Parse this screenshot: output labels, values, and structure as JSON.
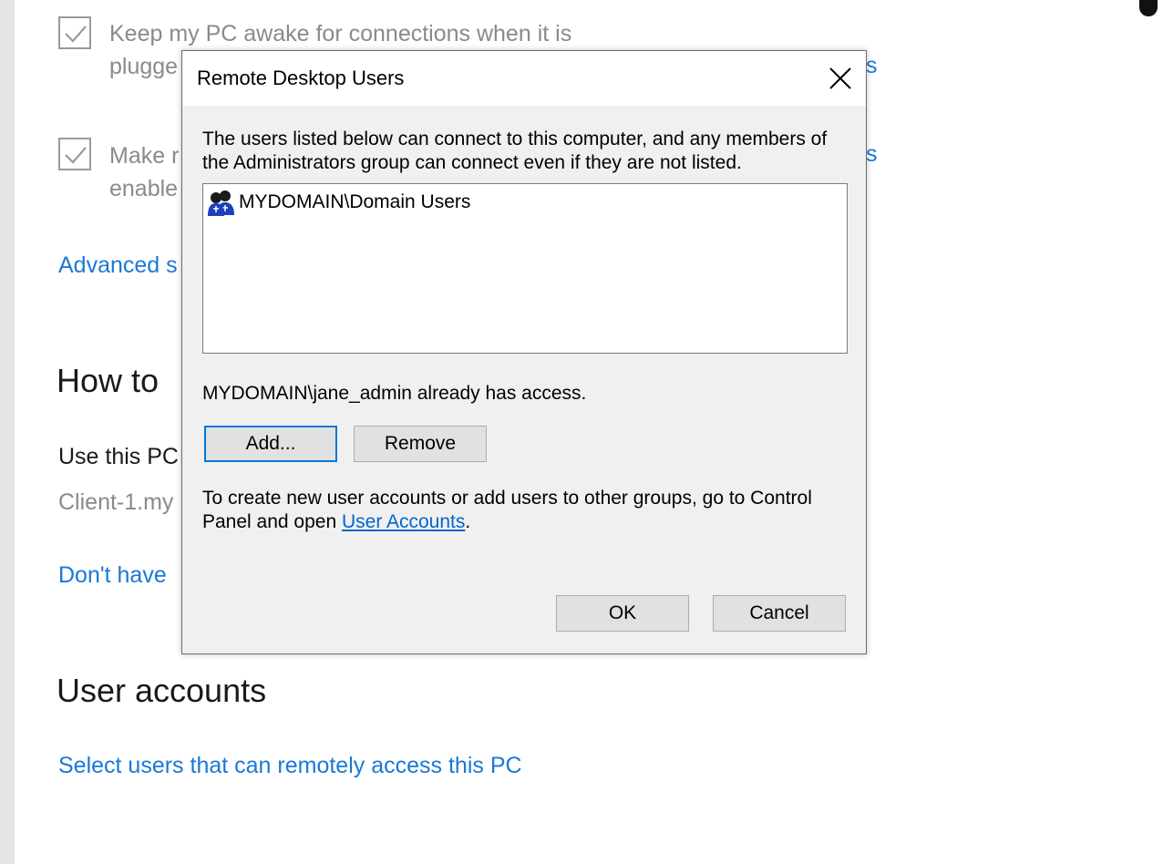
{
  "settings": {
    "keep_awake_text_line1": "Keep my PC awake for connections when it is",
    "keep_awake_text_line2": "plugge",
    "keep_awake_checked": true,
    "keep_awake_right_fragment": "s",
    "make_text_line1": "Make r",
    "make_text_line2": "enable",
    "make_checked": true,
    "make_right_fragment": "s",
    "advanced_link": "Advanced s",
    "how_to_heading": "How to",
    "use_this_pc_label": "Use this PC",
    "pc_name_fragment": "Client-1.my",
    "dont_have_link": "Don't have",
    "user_accounts_heading": "User accounts",
    "select_users_link": "Select users that can remotely access this PC"
  },
  "dialog": {
    "title": "Remote Desktop Users",
    "description": "The users listed below can connect to this computer, and any members of the Administrators group can connect even if they are not listed.",
    "users": [
      {
        "name": "MYDOMAIN\\Domain Users",
        "icon": "user-group-icon"
      }
    ],
    "access_message": "MYDOMAIN\\jane_admin already has access.",
    "add_button": "Add...",
    "remove_button": "Remove",
    "info_prefix": "To create new user accounts or add users to other groups, go to Control Panel and open ",
    "info_link": "User Accounts",
    "info_suffix": ".",
    "ok_button": "OK",
    "cancel_button": "Cancel"
  },
  "colors": {
    "link": "#1a78d7",
    "dialog_bg": "#f0f0f0",
    "default_button_border": "#0078d7"
  }
}
